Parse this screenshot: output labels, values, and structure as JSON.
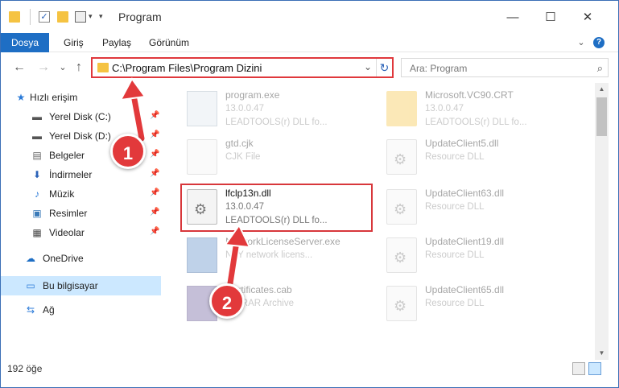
{
  "window": {
    "title": "Program",
    "controls": {
      "minimize": "—",
      "maximize": "☐",
      "close": "✕"
    }
  },
  "ribbon": {
    "tabs": [
      "Dosya",
      "Giriş",
      "Paylaş",
      "Görünüm"
    ],
    "expand_glyph": "⌄",
    "help_glyph": "?"
  },
  "nav": {
    "back_glyph": "←",
    "forward_glyph": "→",
    "recent_glyph": "⌄",
    "up_glyph": "↑",
    "address": "C:\\Program Files\\Program Dizini",
    "refresh_glyph": "↻",
    "search_placeholder": "Ara: Program",
    "search_glyph": "⌕"
  },
  "sidebar": {
    "items": [
      {
        "label": "Hızlı erişim",
        "icon": "star-icon",
        "glyph": "★",
        "color": "#2a7ad8"
      },
      {
        "label": "Yerel Disk (C:)",
        "icon": "drive-icon",
        "glyph": "▬",
        "color": "#555555",
        "pin": "📌"
      },
      {
        "label": "Yerel Disk (D:)",
        "icon": "drive-icon",
        "glyph": "▬",
        "color": "#555555",
        "pin": "📌"
      },
      {
        "label": "Belgeler",
        "icon": "documents-icon",
        "glyph": "▤",
        "color": "#666666",
        "pin": "📌"
      },
      {
        "label": "İndirmeler",
        "icon": "download-icon",
        "glyph": "⬇",
        "color": "#2a62b8",
        "pin": "📌"
      },
      {
        "label": "Müzik",
        "icon": "music-icon",
        "glyph": "♪",
        "color": "#2a7ad8",
        "pin": "📌"
      },
      {
        "label": "Resimler",
        "icon": "pictures-icon",
        "glyph": "▣",
        "color": "#3a7ab8",
        "pin": "📌"
      },
      {
        "label": "Videolar",
        "icon": "videos-icon",
        "glyph": "▦",
        "color": "#444444",
        "pin": "📌"
      },
      {
        "label": "OneDrive",
        "icon": "cloud-icon",
        "glyph": "☁",
        "color": "#1e6ec4"
      },
      {
        "label": "Bu bilgisayar",
        "icon": "computer-icon",
        "glyph": "▭",
        "color": "#2a7ad8"
      },
      {
        "label": "Ağ",
        "icon": "network-icon",
        "glyph": "⇆",
        "color": "#2a7ad8"
      }
    ]
  },
  "files": [
    {
      "name": "program.exe",
      "sub1": "13.0.0.47",
      "sub2": "LEADTOOLS(r) DLL fo...",
      "icon": "exe-icon",
      "faded": true
    },
    {
      "name": "Microsoft.VC90.CRT",
      "sub1": "13.0.0.47",
      "sub2": "LEADTOOLS(r) DLL fo...",
      "icon": "folder-icon",
      "faded": true
    },
    {
      "name": "gtd.cjk",
      "sub1": "CJK File",
      "sub2": "",
      "icon": "file-icon",
      "faded": true
    },
    {
      "name": "UpdateClient5.dll",
      "sub1": "Resource DLL",
      "sub2": "",
      "icon": "dll-icon",
      "faded": true
    },
    {
      "name": "lfclp13n.dll",
      "sub1": "13.0.0.47",
      "sub2": "LEADTOOLS(r) DLL fo...",
      "icon": "dll-icon",
      "faded": false
    },
    {
      "name": "UpdateClient63.dll",
      "sub1": "Resource DLL",
      "sub2": "",
      "icon": "dll-icon",
      "faded": true
    },
    {
      "name": "NetworkLicenseServer.exe",
      "sub1": "NAY network licens...",
      "sub2": "",
      "icon": "exe-icon",
      "faded": true
    },
    {
      "name": "UpdateClient19.dll",
      "sub1": "Resource DLL",
      "sub2": "",
      "icon": "dll-icon",
      "faded": true
    },
    {
      "name": "Certificates.cab",
      "sub1": "WinRAR Archive",
      "sub2": "",
      "icon": "archive-icon",
      "faded": true
    },
    {
      "name": "UpdateClient65.dll",
      "sub1": "Resource DLL",
      "sub2": "",
      "icon": "dll-icon",
      "faded": true
    }
  ],
  "status": {
    "count": "192 öğe"
  },
  "annotations": {
    "badge1": "1",
    "badge2": "2",
    "color": "#e2393b"
  }
}
